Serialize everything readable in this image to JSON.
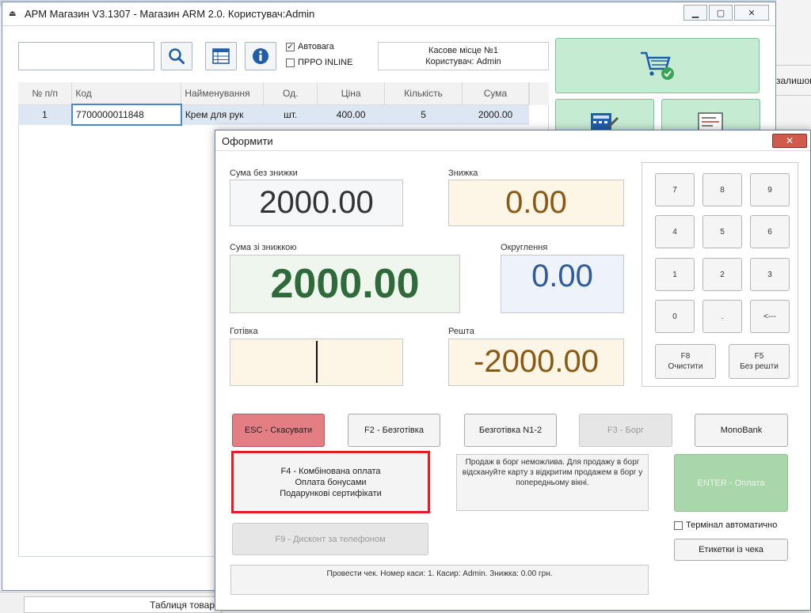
{
  "main_window": {
    "title": "АРМ Магазин V3.1307 - Магазин ARM 2.0. Користувач:Admin",
    "controls": {
      "minimize": "▁",
      "maximize": "▢",
      "close": "✕"
    },
    "search": {
      "value": "",
      "placeholder": ""
    },
    "checkboxes": [
      {
        "label": "Автовага",
        "checked": true
      },
      {
        "label": "ПРРО INLINE",
        "checked": false
      }
    ],
    "kasa_info": {
      "line1": "Касове місце №1",
      "line2": "Користувач: Admin"
    },
    "right_partial_label": "залишок",
    "bottom_tab_label": "Таблиця товар",
    "table": {
      "columns": [
        "№ п/п",
        "Код",
        "Найменування",
        "Од.",
        "Ціна",
        "Кількість",
        "Сума"
      ],
      "rows": [
        {
          "num": "1",
          "code": "7700000011848",
          "name": "Крем для рук",
          "unit": "шт.",
          "price": "400.00",
          "qty": "5",
          "sum": "2000.00"
        }
      ]
    },
    "icons": [
      "search-icon",
      "table-icon",
      "info-icon",
      "cart-check-icon",
      "calculator-icon",
      "receipt-icon"
    ]
  },
  "dialog": {
    "title": "Оформити",
    "close_glyph": "✕",
    "fields": {
      "sum_no_discount": {
        "label": "Сума без знижки",
        "value": "2000.00",
        "color": "#333333",
        "bg": "#f6f7f9"
      },
      "discount": {
        "label": "Знижка",
        "value": "0.00",
        "color": "#8a5a14",
        "bg": "#fdf5e6"
      },
      "sum_with_discount": {
        "label": "Сума зі знижкою",
        "value": "2000.00",
        "color": "#2f6b3a",
        "bg": "#eef6ee"
      },
      "rounding": {
        "label": "Округлення",
        "value": "0.00",
        "color": "#2f5b9a",
        "bg": "#eef3fb"
      },
      "cash": {
        "label": "Готівка",
        "value": "",
        "bg": "#fdf5e6"
      },
      "change": {
        "label": "Решта",
        "value": "-2000.00",
        "color": "#8a5a14",
        "bg": "#fdf5e6"
      }
    },
    "numpad": {
      "keys": [
        "7",
        "8",
        "9",
        "4",
        "5",
        "6",
        "1",
        "2",
        "3",
        "0",
        ".",
        "<---"
      ],
      "clear": {
        "key": "F8",
        "label": "Очистити"
      },
      "no_change": {
        "key": "F5",
        "label": "Без решти"
      }
    },
    "buttons": {
      "cancel": "ESC - Скасувати",
      "cashless": "F2 - Безготівка",
      "cashless_n": "Безготівка N1-2",
      "debt": "F3 - Борг",
      "monobank": "MonoBank",
      "combined": [
        "F4 - Комбінована оплата",
        "Оплата бонусами",
        "Подарункові сертифікати"
      ],
      "pay": "ENTER - Оплата",
      "discount_by_phone": "F9 - Дисконт за телефоном",
      "receipt_labels": "Етикетки із чека"
    },
    "debt_info": "Продаж в борг неможлива. Для продажу в борг відскануйте карту з відкритим продажем в борг у попередньому вікні.",
    "terminal_auto": {
      "label": "Термінал автоматично",
      "checked": false
    },
    "status": "Провести чек. Номер каси: 1. Касир: Admin. Знижка: 0.00 грн."
  }
}
